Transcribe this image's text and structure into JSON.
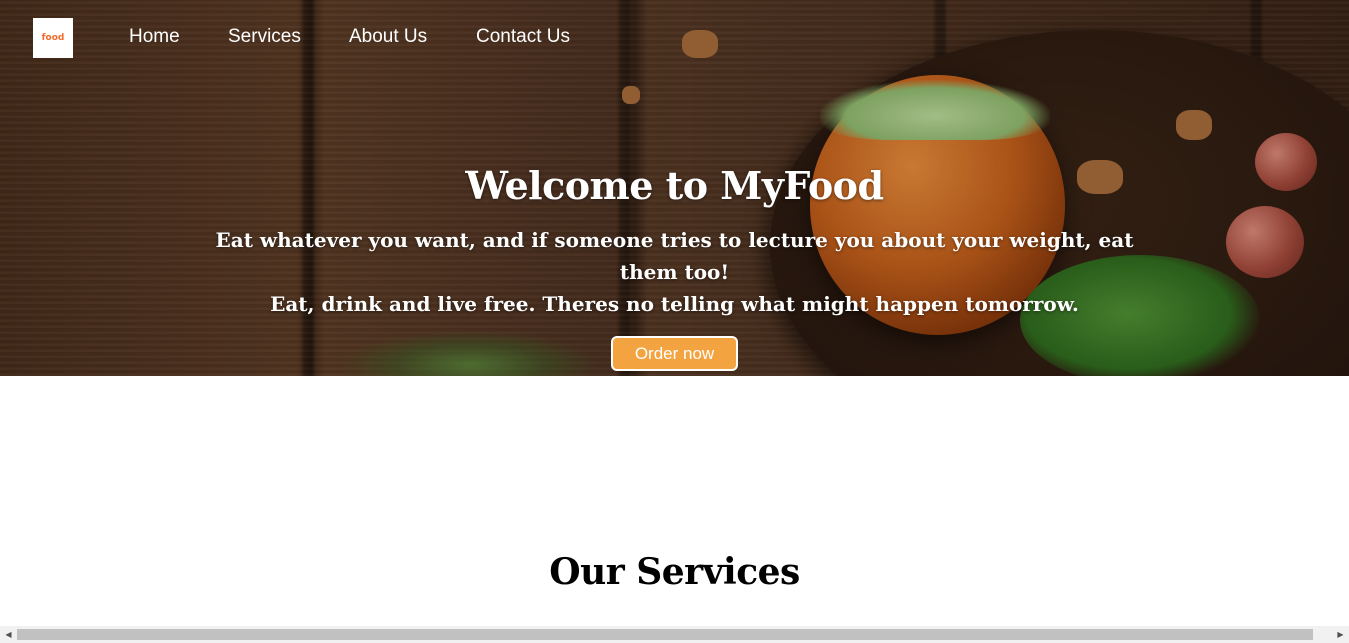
{
  "brand": {
    "logo_text": "food",
    "accent": "#f36b2c"
  },
  "nav": {
    "items": [
      {
        "label": "Home"
      },
      {
        "label": "Services"
      },
      {
        "label": "About Us"
      },
      {
        "label": "Contact Us"
      }
    ]
  },
  "hero": {
    "title": "Welcome to MyFood",
    "subtitle_line1": "Eat whatever you want, and if someone tries to lecture you about your weight, eat them too!",
    "subtitle_line2": "Eat, drink and live free. Theres no telling what might happen tomorrow.",
    "cta_label": "Order now",
    "cta_color": "#f3a33f"
  },
  "services": {
    "title": "Our Services"
  },
  "scrollbar": {
    "left_arrow": "◀",
    "right_arrow": "▶"
  }
}
